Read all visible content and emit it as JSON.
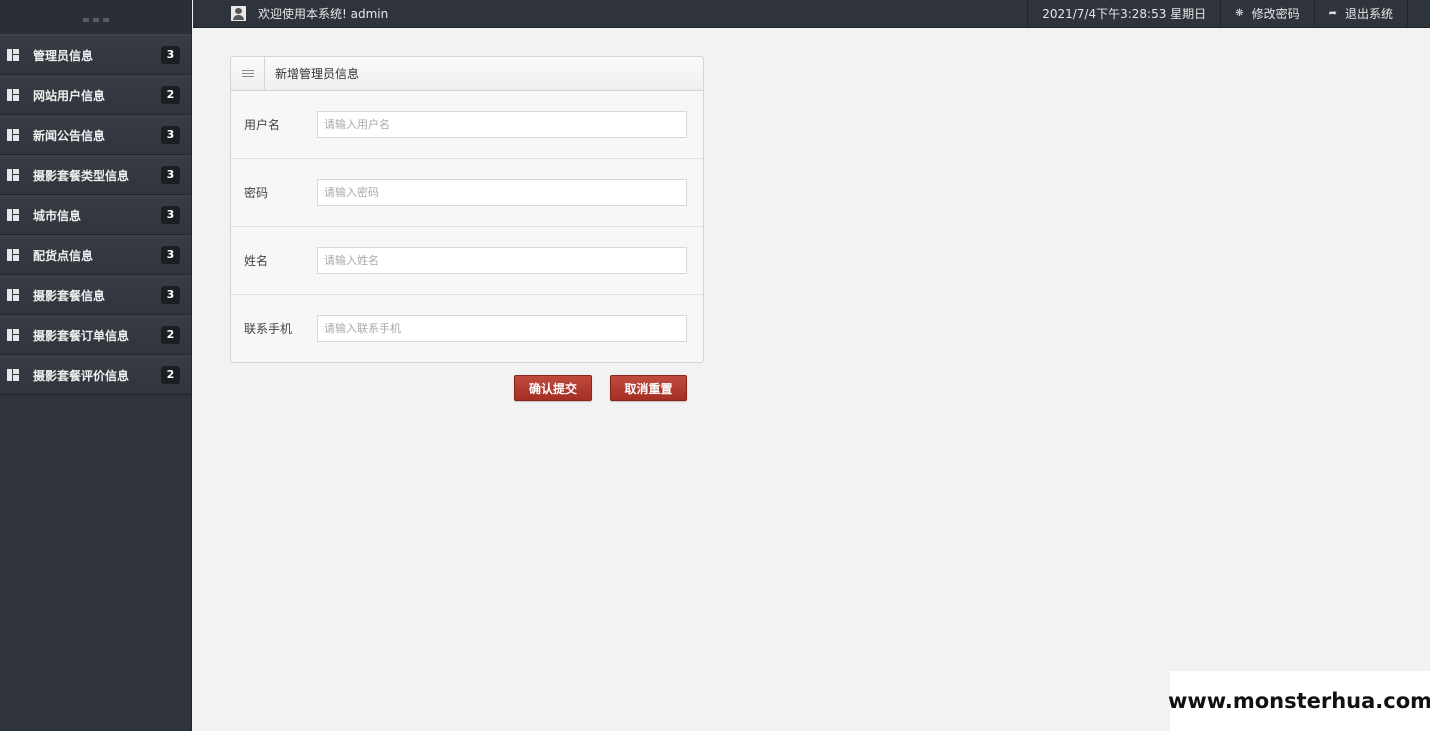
{
  "topbar": {
    "welcome": "欢迎使用本系统! admin",
    "datetime": "2021/7/4下午3:28:53 星期日",
    "change_password": "修改密码",
    "logout": "退出系统"
  },
  "sidebar": {
    "items": [
      {
        "label": "管理员信息",
        "badge": "3"
      },
      {
        "label": "网站用户信息",
        "badge": "2"
      },
      {
        "label": "新闻公告信息",
        "badge": "3"
      },
      {
        "label": "摄影套餐类型信息",
        "badge": "3"
      },
      {
        "label": "城市信息",
        "badge": "3"
      },
      {
        "label": "配货点信息",
        "badge": "3"
      },
      {
        "label": "摄影套餐信息",
        "badge": "3"
      },
      {
        "label": "摄影套餐订单信息",
        "badge": "2"
      },
      {
        "label": "摄影套餐评价信息",
        "badge": "2"
      }
    ]
  },
  "panel": {
    "title": "新增管理员信息",
    "fields": [
      {
        "label": "用户名",
        "placeholder": "请输入用户名"
      },
      {
        "label": "密码",
        "placeholder": "请输入密码"
      },
      {
        "label": "姓名",
        "placeholder": "请输入姓名"
      },
      {
        "label": "联系手机",
        "placeholder": "请输入联系手机"
      }
    ]
  },
  "buttons": {
    "submit": "确认提交",
    "reset": "取消重置"
  },
  "watermark": "www.monsterhua.com",
  "colors": {
    "sidebar_bg": "#2f333b",
    "button_red": "#a32f25",
    "content_bg": "#f2f2f2"
  }
}
